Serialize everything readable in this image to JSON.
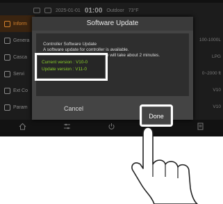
{
  "status": {
    "date": "2025-01-01",
    "time": "01:00",
    "outdoor_label": "Outdoor",
    "outdoor_temp": "73°F"
  },
  "sidebar": {
    "items": [
      {
        "label": "Inform"
      },
      {
        "label": "Genera"
      },
      {
        "label": "Casca"
      },
      {
        "label": "Servi"
      },
      {
        "label": "Ext Co"
      },
      {
        "label": "Param"
      }
    ]
  },
  "right_values": [
    "",
    "100-1000L",
    "LPG",
    "0~2000 ft",
    "V10",
    "V10"
  ],
  "dialog": {
    "title": "Software Update",
    "message_line1": "Controller Software Update",
    "message_line2": "A software update for controller is available.",
    "message_line3": "date will take about 2 minutes.",
    "current_version": "Current version : V10-0",
    "update_version": "Update version : V11-0",
    "cancel_label": "Cancel",
    "done_label": "Done"
  },
  "colors": {
    "accent": "#d4812c",
    "version_text": "#8bd12a"
  },
  "icons": [
    "wifi-icon",
    "lock-icon",
    "home-icon",
    "sliders-icon",
    "power-icon",
    "list-icon"
  ]
}
